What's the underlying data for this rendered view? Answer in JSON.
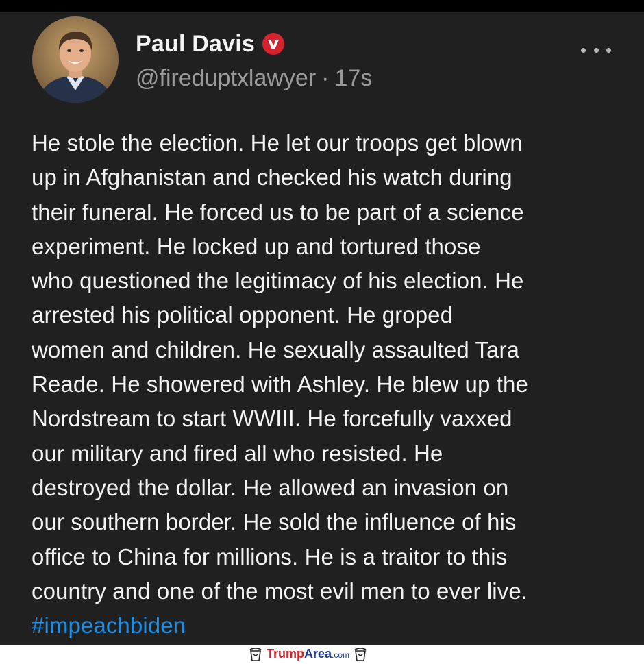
{
  "tweet": {
    "author": {
      "name": "Paul Davis",
      "handle": "@fireduptxlawyer",
      "separator": "·",
      "timestamp": "17s",
      "avatar": "portrait-photo",
      "verified_icon": "verified-badge-icon",
      "verified_color": "#d6232d"
    },
    "more_icon": "more-options-icon",
    "body_lines": [
      "He stole the election. He let our troops get blown",
      "up in Afghanistan and checked his watch during",
      "their funeral. He forced us to be part of a science",
      "experiment. He locked up and tortured those",
      "who questioned the legitimacy of his election. He",
      "arrested his political opponent. He groped",
      "women and children. He sexually assaulted Tara",
      "Reade. He showered with Ashley. He blew up the",
      "Nordstream to start WWIII. He forcefully vaxxed",
      "our military and fired all who resisted. He",
      "destroyed the dollar. He allowed an invasion on",
      "our southern border. He sold the influence of his",
      "office to China for millions. He is a traitor to this",
      "country and one of the most evil men to ever live."
    ],
    "hashtag": "#impeachbiden",
    "hashtag_color": "#1d8fe6",
    "background_color": "#202020"
  },
  "watermark": {
    "brand_trump": "Trump",
    "brand_area": "Area",
    "brand_domain": ".com",
    "icon": "cup-icon",
    "trump_color": "#d42127",
    "area_color": "#1f3e8f"
  }
}
